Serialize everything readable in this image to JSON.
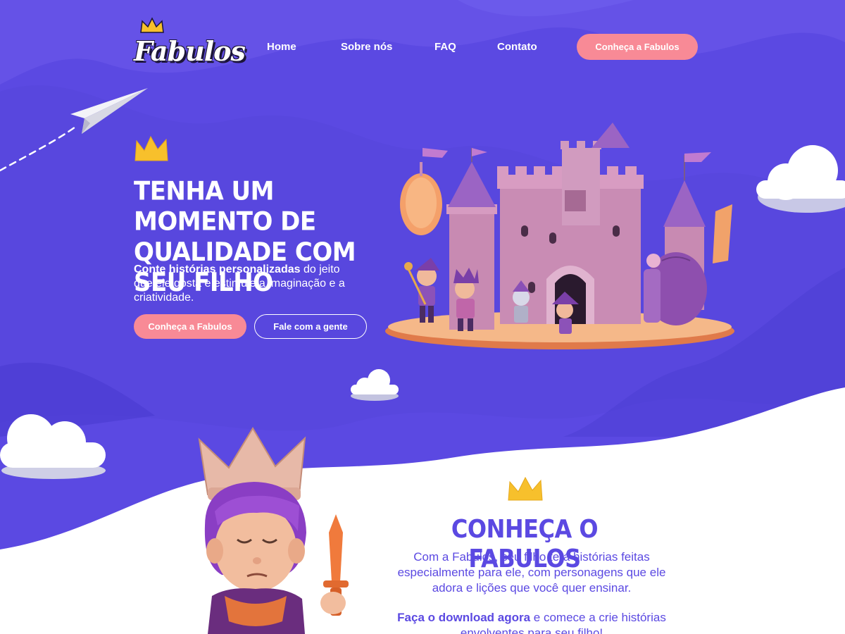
{
  "brand": {
    "name": "Fabulos"
  },
  "nav": {
    "items": [
      "Home",
      "Sobre nós",
      "FAQ",
      "Contato"
    ],
    "cta": "Conheça a Fabulos"
  },
  "hero": {
    "title": "Tenha um momento de qualidade com seu filho",
    "desc_bold": "Conte histórias personalizadas",
    "desc_rest": " do jeito que ele gosta e estimule a imaginação e a criatividade.",
    "primary_button": "Conheça a Fabulos",
    "secondary_button": "Fale com a gente"
  },
  "about": {
    "title": "Conheça o Fabulos",
    "paragraph": "Com a Fabulos, seu filho terá histórias feitas especialmente para ele, com personagens que ele adora e lições que você quer ensinar.",
    "cta_bold": "Faça o download agora",
    "cta_rest": " e comece a crie histórias envolventes para seu filho!"
  },
  "colors": {
    "primary": "#5b49e2",
    "accent_pink": "#f88a96",
    "crown_yellow": "#f7c02c",
    "white": "#ffffff"
  },
  "icons": [
    "crown-icon",
    "paper-plane-icon",
    "cloud-icon",
    "castle-illustration",
    "king-character-illustration"
  ]
}
